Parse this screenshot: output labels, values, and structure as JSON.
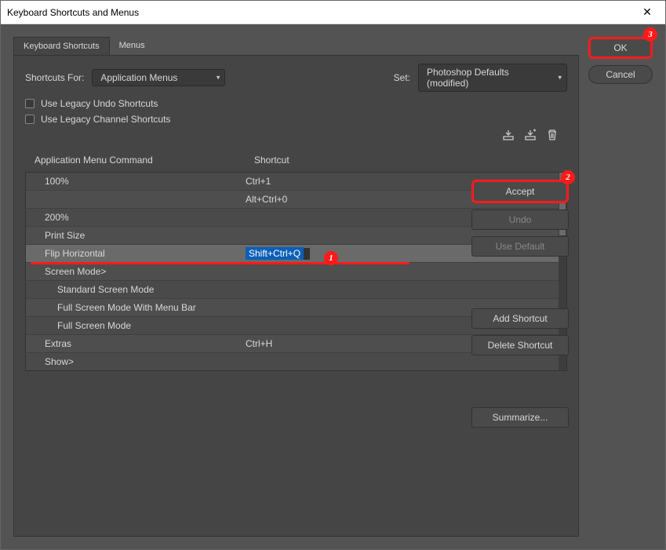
{
  "window": {
    "title": "Keyboard Shortcuts and Menus"
  },
  "tabs": {
    "shortcuts": "Keyboard Shortcuts",
    "menus": "Menus"
  },
  "labels": {
    "shortcuts_for": "Shortcuts For:",
    "set": "Set:",
    "use_legacy_undo": "Use Legacy Undo Shortcuts",
    "use_legacy_channel": "Use Legacy Channel Shortcuts",
    "col_command": "Application Menu Command",
    "col_shortcut": "Shortcut"
  },
  "selects": {
    "shortcuts_for": "Application Menus",
    "set": "Photoshop Defaults (modified)"
  },
  "side": {
    "ok": "OK",
    "cancel": "Cancel"
  },
  "actions": {
    "accept": "Accept",
    "undo": "Undo",
    "use_default": "Use Default",
    "add_shortcut": "Add Shortcut",
    "delete_shortcut": "Delete Shortcut",
    "summarize": "Summarize..."
  },
  "rows": [
    {
      "cmd": "100%",
      "sc": "Ctrl+1",
      "indent": 0
    },
    {
      "cmd": "",
      "sc": "Alt+Ctrl+0",
      "indent": 0
    },
    {
      "cmd": "200%",
      "sc": "",
      "indent": 0
    },
    {
      "cmd": "Print Size",
      "sc": "",
      "indent": 0
    },
    {
      "cmd": "Flip Horizontal",
      "sc": "Shift+Ctrl+Q",
      "indent": 0,
      "selected": true
    },
    {
      "cmd": "Screen Mode>",
      "sc": "",
      "indent": 0
    },
    {
      "cmd": "Standard Screen Mode",
      "sc": "",
      "indent": 1
    },
    {
      "cmd": "Full Screen Mode With Menu Bar",
      "sc": "",
      "indent": 1
    },
    {
      "cmd": "Full Screen Mode",
      "sc": "",
      "indent": 1
    },
    {
      "cmd": "Extras",
      "sc": "Ctrl+H",
      "indent": 0
    },
    {
      "cmd": "Show>",
      "sc": "",
      "indent": 0
    }
  ],
  "badges": {
    "one": "1",
    "two": "2",
    "three": "3"
  }
}
